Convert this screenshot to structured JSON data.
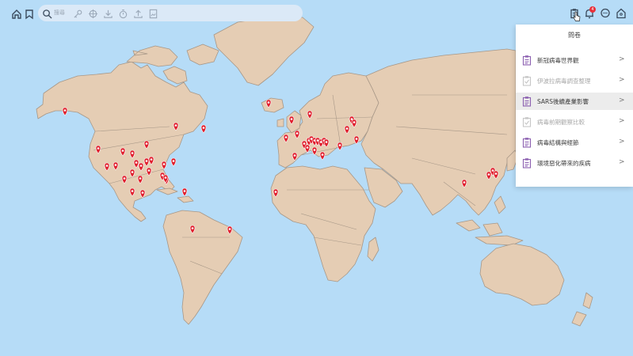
{
  "search": {
    "placeholder": "搜尋"
  },
  "panel": {
    "title": "問卷",
    "items": [
      {
        "label": "新冠病毒世界觀",
        "status": "todo",
        "arrow": ">"
      },
      {
        "label": "伊波拉病毒調查整理",
        "status": "done",
        "arrow": ">"
      },
      {
        "label": "SARS後續產業影響",
        "status": "todo",
        "arrow": ">",
        "selected": true
      },
      {
        "label": "病毒前期觀察比較",
        "status": "done",
        "arrow": ">"
      },
      {
        "label": "病毒結構與經節",
        "status": "todo",
        "arrow": ">"
      },
      {
        "label": "環境惡化帶來的疾病",
        "status": "todo",
        "arrow": ">"
      }
    ]
  },
  "notifications": {
    "count": "4"
  },
  "colors": {
    "ocean": "#b6dcf7",
    "land": "#e5cdb4",
    "marker": "#e0202e",
    "panel_accent": "#8b5fb0"
  },
  "icons": {
    "left": [
      "home-icon",
      "bookmark-icon"
    ],
    "tools": [
      "search-icon",
      "key-icon",
      "crosshair-icon",
      "download-icon",
      "timer-icon",
      "upload-icon",
      "image-icon"
    ],
    "right": [
      "clipboard-icon",
      "bell-icon",
      "chat-icon",
      "location-icon"
    ]
  }
}
